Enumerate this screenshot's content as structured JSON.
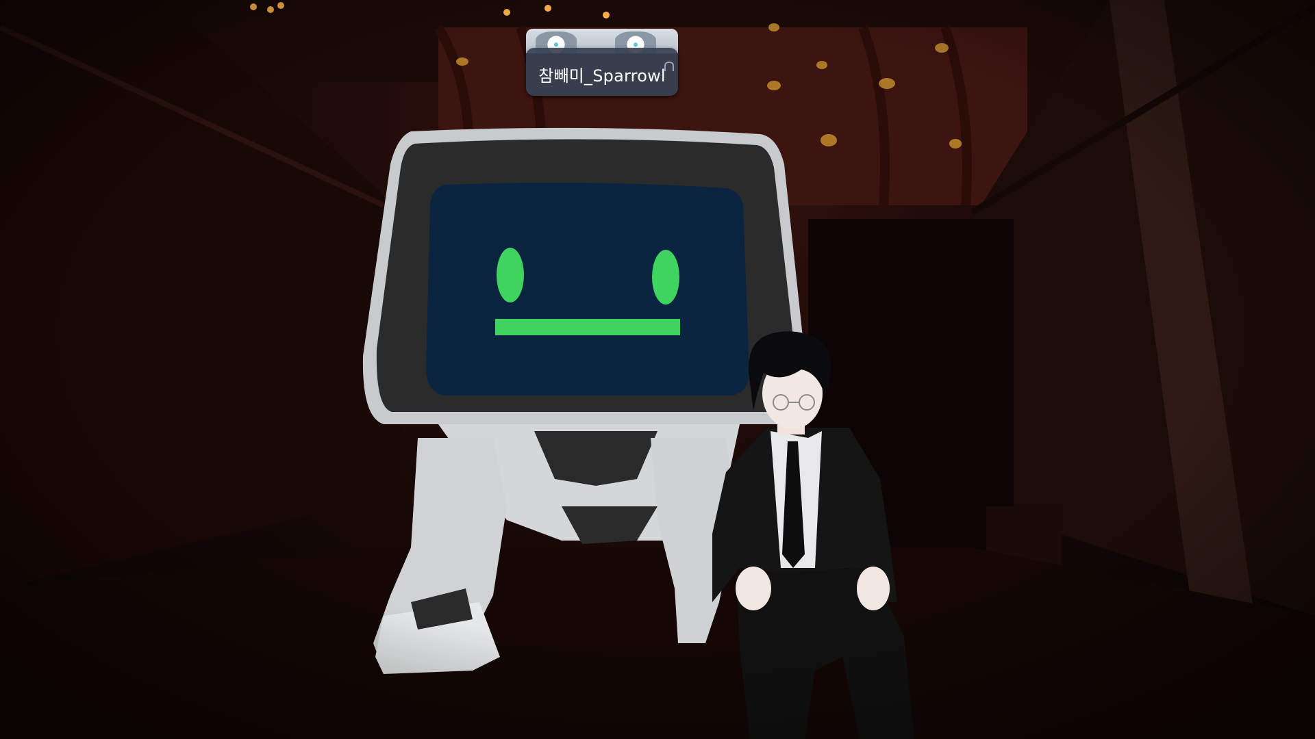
{
  "world": {
    "player_nameplate": {
      "display_name": "참빼미_Sparrowl",
      "icon": "avatar-thumbnail-icon",
      "mic_icon": "headset-icon"
    }
  },
  "colors": {
    "screen_face": "#0b2540",
    "face_glow": "#3fd45f",
    "robot_frame": "#c9cccf",
    "wall": "#1e0b08"
  }
}
